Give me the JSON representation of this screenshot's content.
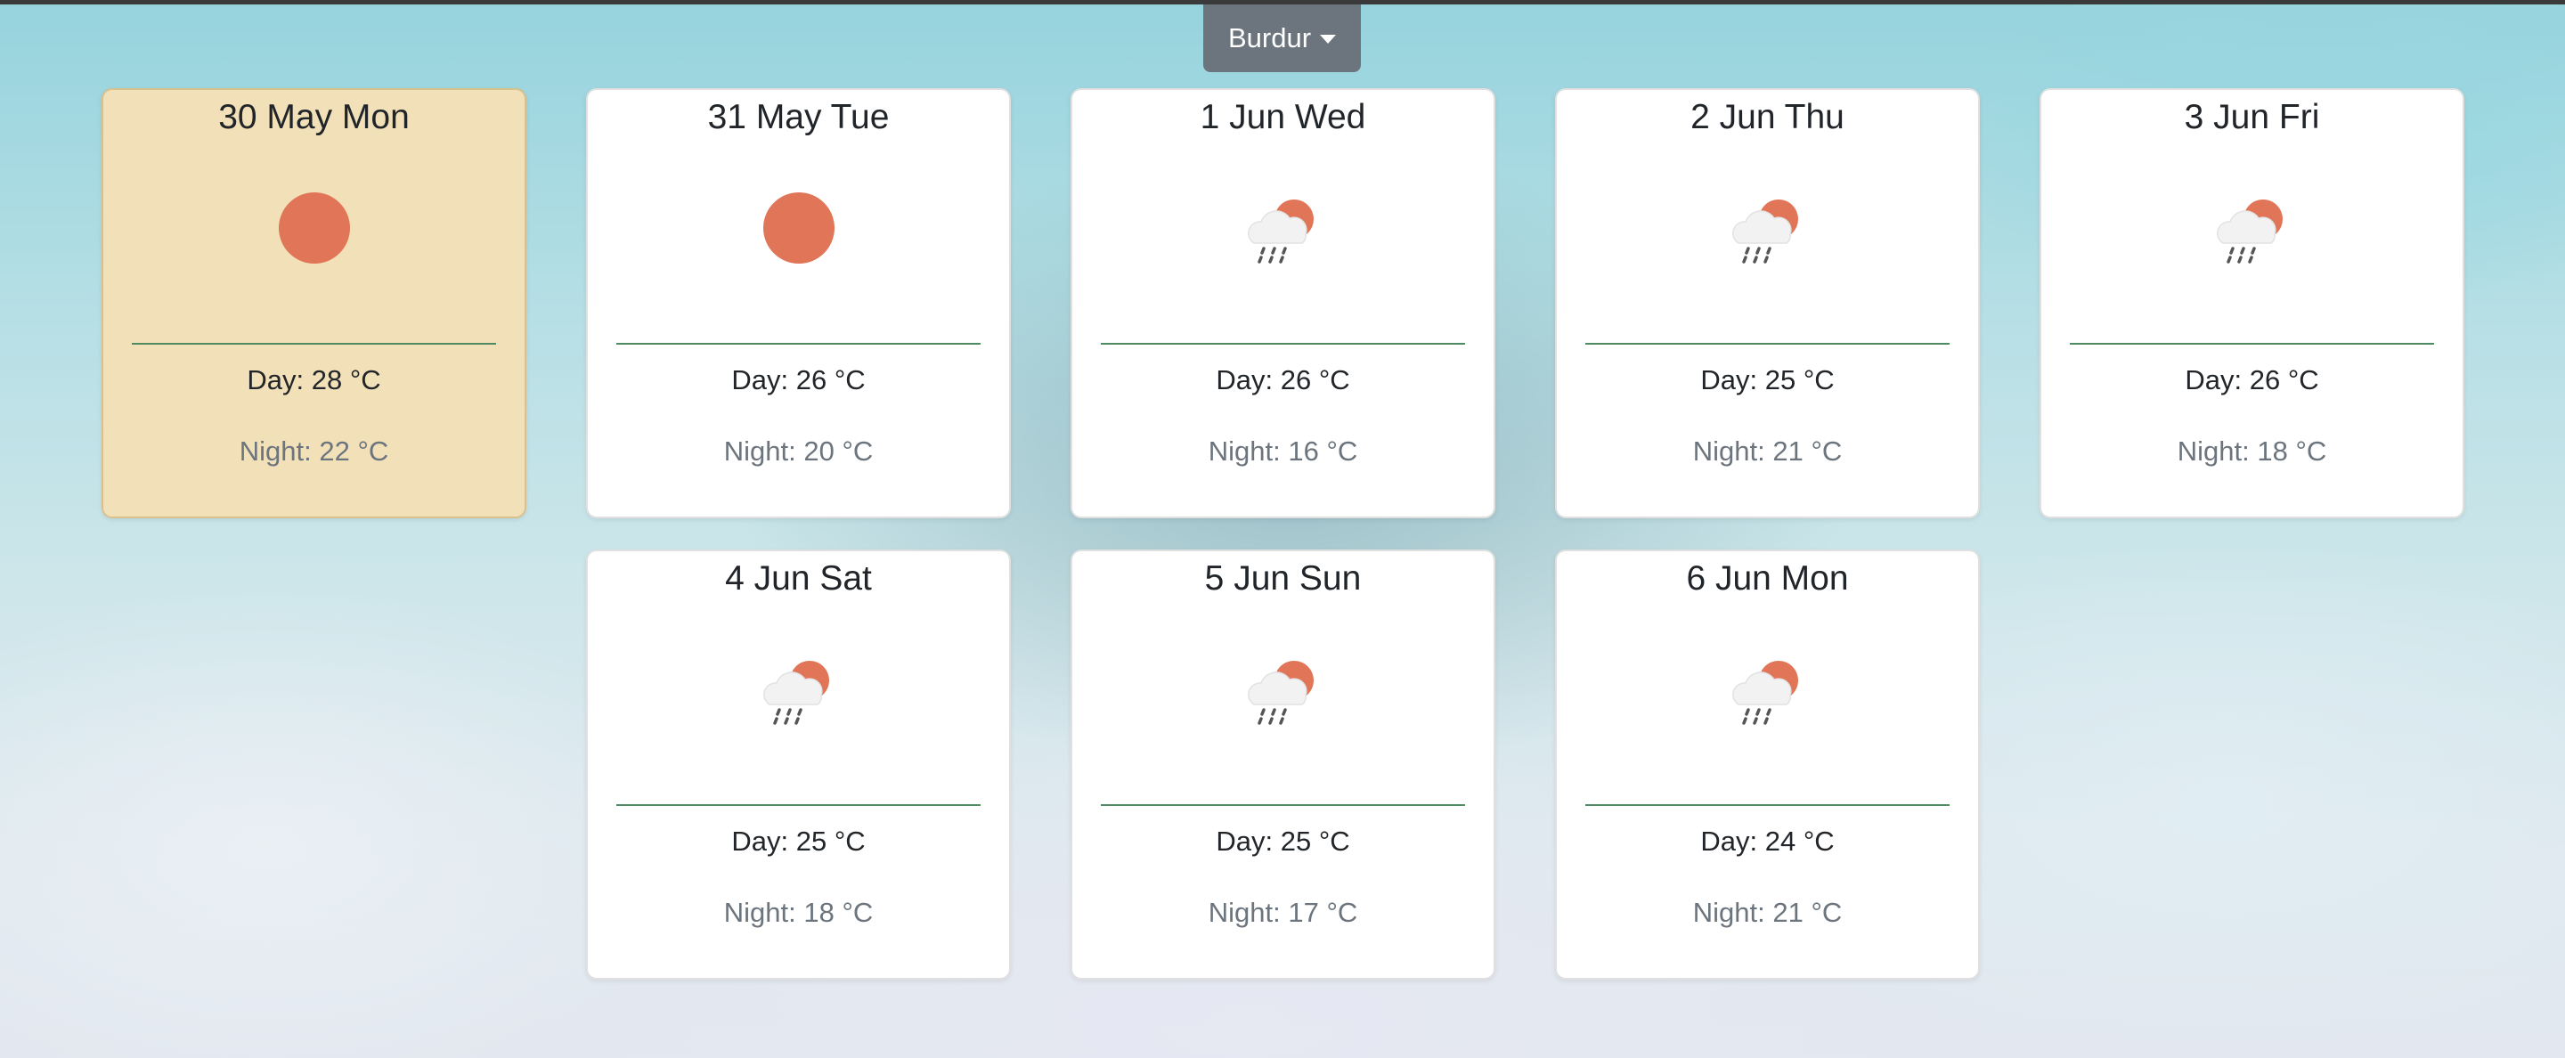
{
  "location_dropdown": {
    "label": "Burdur"
  },
  "forecast": [
    {
      "date": "30 May Mon",
      "icon": "sun-icon",
      "day": "Day: 28 °C",
      "night": "Night: 22 °C",
      "selected": true
    },
    {
      "date": "31 May Tue",
      "icon": "sun-icon",
      "day": "Day: 26 °C",
      "night": "Night: 20 °C"
    },
    {
      "date": "1 Jun Wed",
      "icon": "rain-sun-icon",
      "day": "Day: 26 °C",
      "night": "Night: 16 °C"
    },
    {
      "date": "2 Jun Thu",
      "icon": "rain-sun-icon",
      "day": "Day: 25 °C",
      "night": "Night: 21 °C"
    },
    {
      "date": "3 Jun Fri",
      "icon": "rain-sun-icon",
      "day": "Day: 26 °C",
      "night": "Night: 18 °C"
    },
    {
      "date": "4 Jun Sat",
      "icon": "rain-sun-icon",
      "day": "Day: 25 °C",
      "night": "Night: 18 °C"
    },
    {
      "date": "5 Jun Sun",
      "icon": "rain-sun-icon",
      "day": "Day: 25 °C",
      "night": "Night: 17 °C"
    },
    {
      "date": "6 Jun Mon",
      "icon": "rain-sun-icon",
      "day": "Day: 24 °C",
      "night": "Night: 21 °C"
    }
  ],
  "colors": {
    "selected_card": "#f2e0b9",
    "sun": "#e07558",
    "divider": "#4f8a60",
    "dropdown": "#6c757d",
    "night_text": "#6c757d"
  }
}
